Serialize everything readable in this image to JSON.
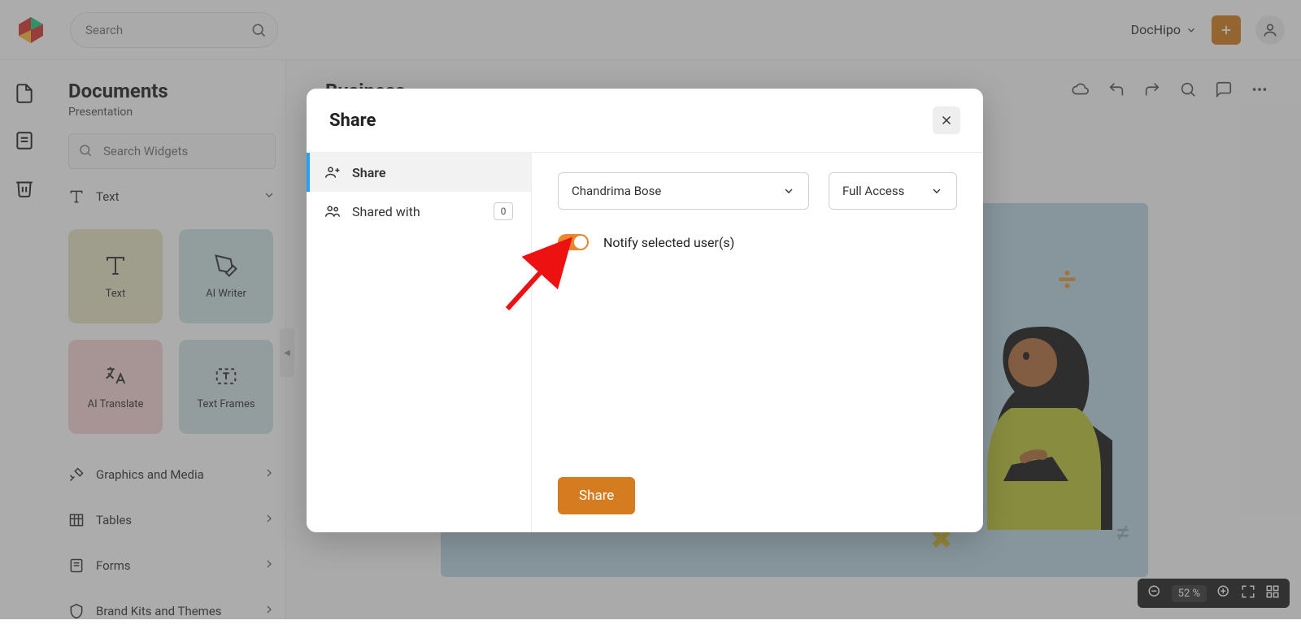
{
  "topbar": {
    "search_placeholder": "Search",
    "workspace": "DocHipo"
  },
  "sidebar": {
    "title": "Documents",
    "subtitle": "Presentation",
    "widget_search_placeholder": "Search Widgets",
    "sections": {
      "text": "Text",
      "graphics": "Graphics and Media",
      "tables": "Tables",
      "forms": "Forms",
      "brand": "Brand Kits and Themes"
    },
    "cards": {
      "text": "Text",
      "ai_writer": "AI Writer",
      "ai_translate": "AI Translate",
      "text_frames": "Text Frames"
    }
  },
  "document": {
    "title": "Business"
  },
  "zoom": {
    "display": "52 %"
  },
  "modal": {
    "title": "Share",
    "nav": {
      "share": "Share",
      "shared_with": "Shared with",
      "shared_count": "0"
    },
    "user_select": "Chandrima Bose",
    "access_select": "Full Access",
    "notify_label": "Notify selected user(s)",
    "share_btn": "Share"
  }
}
